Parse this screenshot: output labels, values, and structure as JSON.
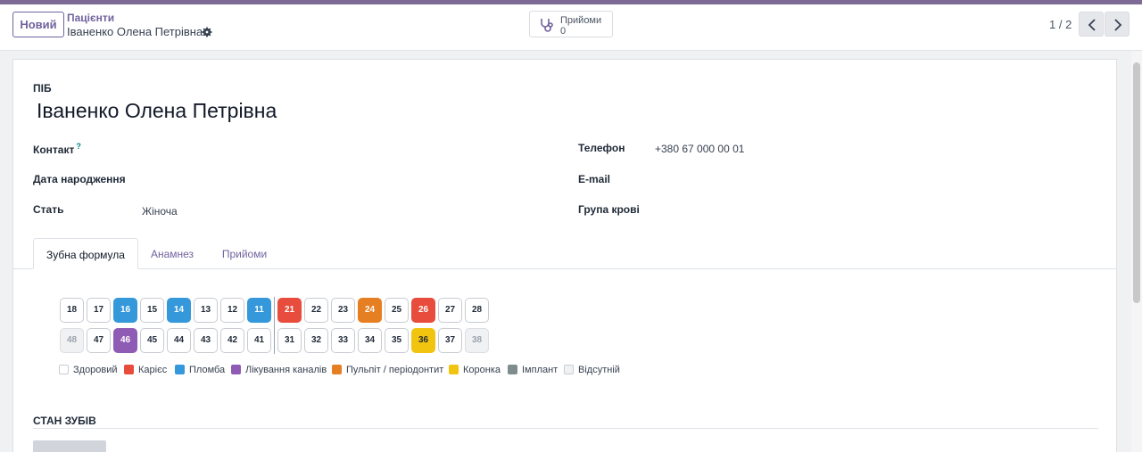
{
  "control_panel": {
    "new_button": "Новий",
    "breadcrumb_parent": "Пацієнти",
    "breadcrumb_current": "Іваненко Олена Петрівна",
    "stat_button": {
      "label": "Прийоми",
      "value": "0"
    },
    "pager": "1 / 2"
  },
  "form": {
    "name_label": "ПІБ",
    "name_value": "Іваненко Олена Петрівна",
    "contact_label": "Контакт",
    "contact_help": "?",
    "birthdate_label": "Дата народження",
    "gender_label": "Стать",
    "gender_value": "Жіноча",
    "phone_label": "Телефон",
    "phone_value": "+380 67 000 00 01",
    "email_label": "E-mail",
    "blood_label": "Група крові"
  },
  "tabs": [
    {
      "label": "Зубна формула",
      "active": true
    },
    {
      "label": "Анамнез",
      "active": false
    },
    {
      "label": "Прийоми",
      "active": false
    }
  ],
  "dental_chart": {
    "upper_row": [
      {
        "num": "18",
        "status": "healthy"
      },
      {
        "num": "17",
        "status": "healthy"
      },
      {
        "num": "16",
        "status": "filling"
      },
      {
        "num": "15",
        "status": "healthy"
      },
      {
        "num": "14",
        "status": "filling"
      },
      {
        "num": "13",
        "status": "healthy"
      },
      {
        "num": "12",
        "status": "healthy"
      },
      {
        "num": "11",
        "status": "filling"
      },
      {
        "num": "21",
        "status": "caries"
      },
      {
        "num": "22",
        "status": "healthy"
      },
      {
        "num": "23",
        "status": "healthy"
      },
      {
        "num": "24",
        "status": "pulpitis"
      },
      {
        "num": "25",
        "status": "healthy"
      },
      {
        "num": "26",
        "status": "caries"
      },
      {
        "num": "27",
        "status": "healthy"
      },
      {
        "num": "28",
        "status": "healthy"
      }
    ],
    "lower_row": [
      {
        "num": "48",
        "status": "missing"
      },
      {
        "num": "47",
        "status": "healthy"
      },
      {
        "num": "46",
        "status": "canal"
      },
      {
        "num": "45",
        "status": "healthy"
      },
      {
        "num": "44",
        "status": "healthy"
      },
      {
        "num": "43",
        "status": "healthy"
      },
      {
        "num": "42",
        "status": "healthy"
      },
      {
        "num": "41",
        "status": "healthy"
      },
      {
        "num": "31",
        "status": "healthy"
      },
      {
        "num": "32",
        "status": "healthy"
      },
      {
        "num": "33",
        "status": "healthy"
      },
      {
        "num": "34",
        "status": "healthy"
      },
      {
        "num": "35",
        "status": "healthy"
      },
      {
        "num": "36",
        "status": "crown"
      },
      {
        "num": "37",
        "status": "healthy"
      },
      {
        "num": "38",
        "status": "missing"
      }
    ]
  },
  "legend": [
    {
      "status": "healthy",
      "label": "Здоровий"
    },
    {
      "status": "caries",
      "label": "Карієс"
    },
    {
      "status": "filling",
      "label": "Пломба"
    },
    {
      "status": "canal",
      "label": "Лікування каналів"
    },
    {
      "status": "pulpitis",
      "label": "Пульпіт / періодонтит"
    },
    {
      "status": "crown",
      "label": "Коронка"
    },
    {
      "status": "implant",
      "label": "Імплант"
    },
    {
      "status": "missing",
      "label": "Відсутній"
    }
  ],
  "status_colors": {
    "healthy": "#ffffff",
    "caries": "#e74c3c",
    "filling": "#3498db",
    "canal": "#8e5cb5",
    "pulpitis": "#e67e22",
    "crown": "#f1c40f",
    "implant": "#7f8c8d",
    "missing": "#f0f1f2"
  },
  "section_title": "СТАН ЗУБІВ"
}
